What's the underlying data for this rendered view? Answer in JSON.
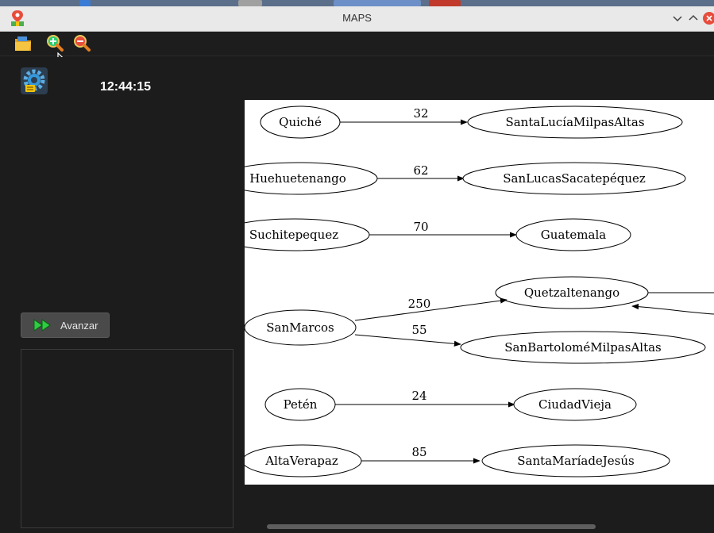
{
  "window": {
    "title": "MAPS"
  },
  "toolbar": {
    "buttons": [
      {
        "name": "open-folder-icon"
      },
      {
        "name": "zoom-in-icon"
      },
      {
        "name": "zoom-out-icon"
      }
    ]
  },
  "sidebar": {
    "clock": "12:44:15",
    "advance_label": "Avanzar"
  },
  "graph": {
    "nodes": {
      "quiche": "Quiché",
      "santa_lucia": "SantaLucíaMilpasAltas",
      "huehuetenango": "Huehuetenango",
      "san_lucas": "SanLucasSacatepéquez",
      "suchitepequez": "Suchitepequez",
      "guatemala": "Guatemala",
      "quetzaltenango": "Quetzaltenango",
      "san_marcos": "SanMarcos",
      "san_bartolome": "SanBartoloméMilpasAltas",
      "peten": "Petén",
      "ciudad_vieja": "CiudadVieja",
      "alta_verapaz": "AltaVerapaz",
      "santa_maria": "SantaMaríadeJesús"
    },
    "edges": {
      "quiche_santa_lucia": "32",
      "huehuetenango_san_lucas": "62",
      "suchitepequez_guatemala": "70",
      "san_marcos_quetzaltenango": "250",
      "san_marcos_san_bartolome": "55",
      "peten_ciudad_vieja": "24",
      "alta_verapaz_santa_maria": "85"
    }
  },
  "colors": {
    "background": "#1c1c1c",
    "titlebar": "#e9e9e9",
    "button": "#4a4a4a",
    "accent_green": "#2ecc40",
    "close_red": "#e74c3c"
  }
}
